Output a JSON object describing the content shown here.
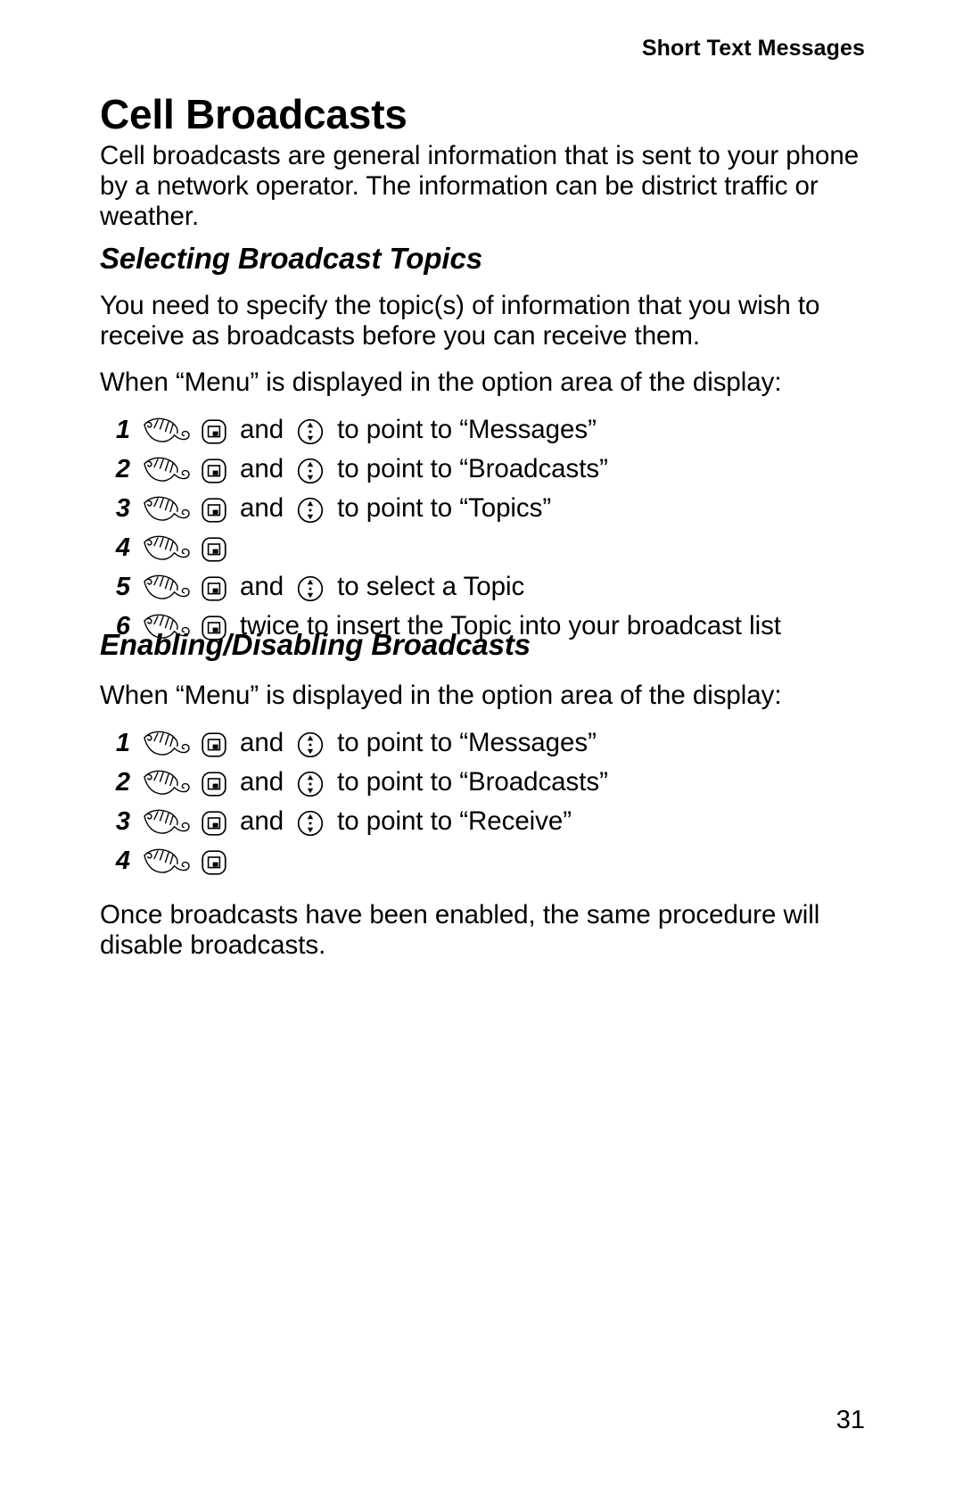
{
  "header": {
    "running_title": "Short Text Messages"
  },
  "page_title": "Cell Broadcasts",
  "intro": "Cell broadcasts are general information that is sent to your phone by a network operator. The information can be district traffic or weather.",
  "sections": [
    {
      "heading": "Selecting Broadcast Topics",
      "lead": "You need to specify the topic(s) of information that you wish to receive as broadcasts before you can receive them.",
      "prompt": "When “Menu” is displayed in the option area of the display:",
      "steps": [
        {
          "number": "1",
          "pre": "",
          "conjunction": "and",
          "post": "to point to “Messages”",
          "icons": [
            "hand-icon",
            "key-icon",
            "nav-pad-icon"
          ]
        },
        {
          "number": "2",
          "pre": "",
          "conjunction": "and",
          "post": "to point to “Broadcasts”",
          "icons": [
            "hand-icon",
            "key-icon",
            "nav-pad-icon"
          ]
        },
        {
          "number": "3",
          "pre": "",
          "conjunction": "and",
          "post": "to point to “Topics”",
          "icons": [
            "hand-icon",
            "key-icon",
            "nav-pad-icon"
          ]
        },
        {
          "number": "4",
          "pre": "",
          "conjunction": "",
          "post": "",
          "icons": [
            "hand-icon",
            "key-icon"
          ]
        },
        {
          "number": "5",
          "pre": "",
          "conjunction": "and",
          "post": "to select a Topic",
          "icons": [
            "hand-icon",
            "key-icon",
            "nav-pad-icon"
          ]
        },
        {
          "number": "6",
          "pre": "",
          "conjunction": "",
          "post": "twice to insert the Topic into your broadcast list",
          "icons": [
            "hand-icon",
            "key-icon"
          ]
        }
      ]
    },
    {
      "heading": "Enabling/Disabling Broadcasts",
      "lead": "",
      "prompt": "When “Menu” is displayed in the option area of the display:",
      "steps": [
        {
          "number": "1",
          "pre": "",
          "conjunction": "and",
          "post": "to point to “Messages”",
          "icons": [
            "hand-icon",
            "key-icon",
            "nav-pad-icon"
          ]
        },
        {
          "number": "2",
          "pre": "",
          "conjunction": "and",
          "post": "to point to “Broadcasts”",
          "icons": [
            "hand-icon",
            "key-icon",
            "nav-pad-icon"
          ]
        },
        {
          "number": "3",
          "pre": "",
          "conjunction": "and",
          "post": "to point to “Receive”",
          "icons": [
            "hand-icon",
            "key-icon",
            "nav-pad-icon"
          ]
        },
        {
          "number": "4",
          "pre": "",
          "conjunction": "",
          "post": "",
          "icons": [
            "hand-icon",
            "key-icon"
          ]
        }
      ],
      "closing": "Once broadcasts have been enabled, the same procedure will disable broadcasts."
    }
  ],
  "page_number": "31",
  "colors": {
    "text": "#000000",
    "background": "#ffffff"
  }
}
